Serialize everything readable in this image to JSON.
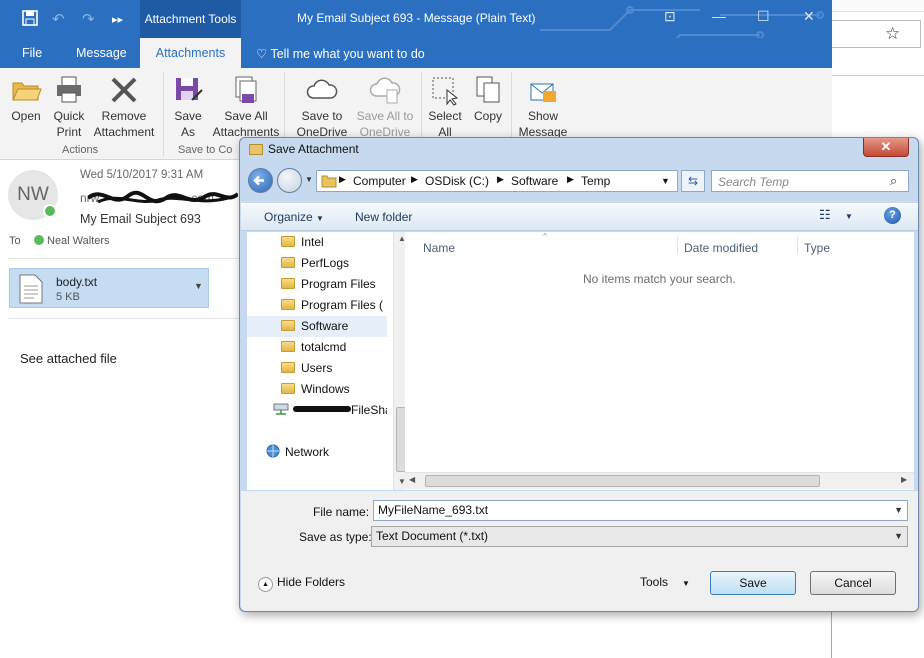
{
  "outlook": {
    "ribbon_context_tab": "Attachment Tools",
    "window_title": "My Email Subject 693  -  Message (Plain Text)",
    "tabs": [
      "File",
      "Message",
      "Attachments"
    ],
    "tell_me": "Tell me what you want to do",
    "ribbon": {
      "open": "Open",
      "quick_print": [
        "Quick",
        "Print"
      ],
      "remove": [
        "Remove",
        "Attachment"
      ],
      "actions_group": "Actions",
      "save_as": [
        "Save",
        "As"
      ],
      "save_all": [
        "Save All",
        "Attachments"
      ],
      "save_to_copy_group": "Save to Co",
      "save_to_onedrive": [
        "Save to",
        "OneDrive"
      ],
      "save_all_to_onedrive": [
        "Save All to",
        "OneDrive"
      ],
      "select_all": [
        "Select",
        "All"
      ],
      "copy": "Copy",
      "show_message": [
        "Show",
        "Message"
      ]
    },
    "message": {
      "avatar_initials": "NW",
      "date": "Wed 5/10/2017 9:31 AM",
      "from_fragment_start": "nrw",
      "from_fragment_end": "com",
      "subject": "My Email Subject 693",
      "to_label": "To",
      "to_name": "Neal Walters",
      "attachment_name": "body.txt",
      "attachment_size": "5 KB",
      "body": "See attached file"
    }
  },
  "dialog": {
    "title": "Save Attachment",
    "breadcrumb": [
      "Computer",
      "OSDisk (C:)",
      "Software",
      "Temp"
    ],
    "search_placeholder": "Search Temp",
    "organize": "Organize",
    "new_folder": "New folder",
    "nav_items": [
      "Intel",
      "PerfLogs",
      "Program Files",
      "Program Files (",
      "Software",
      "totalcmd",
      "Users",
      "Windows"
    ],
    "selected_nav": "Software",
    "share_suffix": "FileShare",
    "network": "Network",
    "columns": [
      "Name",
      "Date modified",
      "Type"
    ],
    "empty_message": "No items match your search.",
    "file_name_label": "File name:",
    "file_name_value": "MyFileName_693.txt",
    "save_type_label": "Save as type:",
    "save_type_value": "Text Document (*.txt)",
    "hide_folders": "Hide Folders",
    "tools": "Tools",
    "save": "Save",
    "cancel": "Cancel"
  },
  "colors": {
    "outlook_blue": "#2b6fc0",
    "dialog_frame": "#c7d9ee",
    "attachment_fill": "#c5dcf2",
    "presence_green": "#5cb85c",
    "close_red": "#c44a35"
  }
}
